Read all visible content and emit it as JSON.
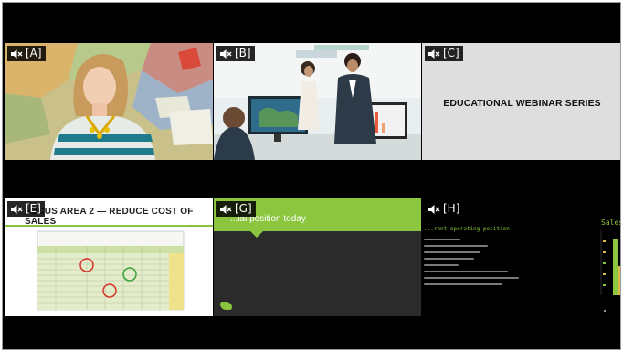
{
  "tiles": [
    {
      "id": "A",
      "label": "[A]",
      "muted": true
    },
    {
      "id": "B",
      "label": "[B]",
      "muted": true
    },
    {
      "id": "C",
      "label": "[C]",
      "muted": true,
      "text": "EDUCATIONAL WEBINAR SERIES"
    },
    {
      "id": "E",
      "label": "[E]",
      "muted": true,
      "heading": "FOCUS AREA 2 — REDUCE COST OF SALES"
    },
    {
      "id": "G",
      "label": "[G]",
      "muted": true,
      "heading": "...ial position today"
    },
    {
      "id": "H",
      "label": "[H]",
      "muted": true,
      "subheading": "...rent operating position",
      "side_label": "Sales"
    }
  ],
  "colors": {
    "background": "#000000",
    "accent_green": "#8cc63f",
    "tile_c_background": "#dedede",
    "tile_g_background": "#2b2b2b"
  },
  "icons": {
    "mute": "speaker-muted-icon"
  }
}
